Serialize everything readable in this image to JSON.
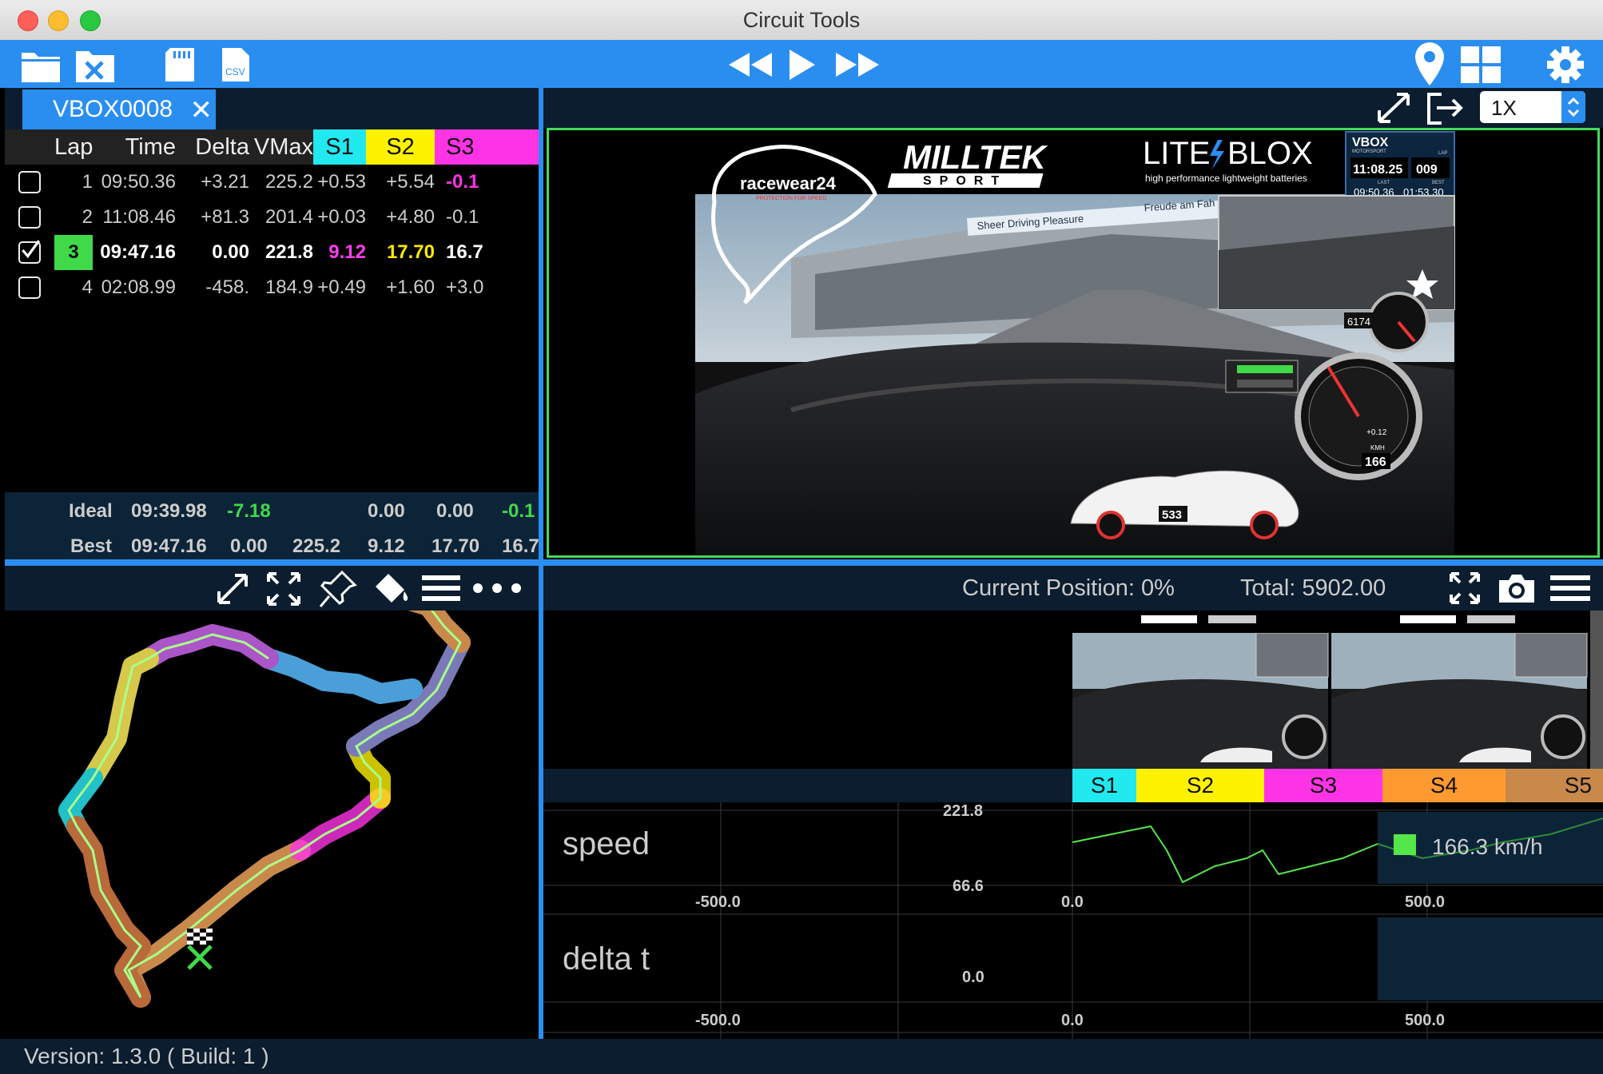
{
  "window": {
    "title": "Circuit Tools"
  },
  "toolbar": {
    "left_icons": [
      "folder-open-icon",
      "close-file-icon",
      "sd-card-icon",
      "csv-file-icon"
    ],
    "playback_icons": [
      "rewind-icon",
      "play-icon",
      "fast-forward-icon"
    ],
    "right_icons": [
      "map-pin-icon",
      "layout-grid-icon",
      "settings-gear-icon"
    ]
  },
  "session_tab": {
    "label": "VBOX0008",
    "close": "✕"
  },
  "lap_table": {
    "headers": [
      "Lap",
      "Time",
      "Delta",
      "VMax",
      "S1",
      "S2",
      "S3"
    ],
    "rows": [
      {
        "checked": false,
        "lap": "1",
        "time": "09:50.36",
        "delta": "+3.21",
        "vmax": "225.2",
        "s1": "+0.53",
        "s2": "+5.54",
        "s3": "-0.1"
      },
      {
        "checked": false,
        "lap": "2",
        "time": "11:08.46",
        "delta": "+81.3",
        "vmax": "201.4",
        "s1": "+0.03",
        "s2": "+4.80",
        "s3": "-0.1"
      },
      {
        "checked": true,
        "lap": "3",
        "time": "09:47.16",
        "delta": "0.00",
        "vmax": "221.8",
        "s1": "9.12",
        "s2": "17.70",
        "s3": "16.7"
      },
      {
        "checked": false,
        "lap": "4",
        "time": "02:08.99",
        "delta": "-458.",
        "vmax": "184.9",
        "s1": "+0.49",
        "s2": "+1.60",
        "s3": "+3.0"
      }
    ],
    "ideal": {
      "label": "Ideal",
      "time": "09:39.98",
      "delta": "-7.18",
      "s1": "0.00",
      "s2": "0.00",
      "s3": "-0.1"
    },
    "best": {
      "label": "Best",
      "time": "09:47.16",
      "delta": "0.00",
      "vmax": "225.2",
      "s1": "9.12",
      "s2": "17.70",
      "s3": "16.7"
    }
  },
  "video": {
    "speed_option": "1X",
    "overlay": {
      "brand_main": "MILLTEK",
      "brand_sub": "SPORT",
      "brand2_a": "LITE",
      "brand2_b": "BLOX",
      "brand2_tagline": "high performance lightweight batteries",
      "sponsor": "racewear24",
      "sponsor_tag": "PROTECTION FOR SPEED",
      "vbox_label": "VBOX",
      "vbox_sub": "MOTORSPORT",
      "vbox_time": "11:08.25",
      "vbox_lap_label": "LAP",
      "vbox_lap": "009",
      "vbox_last_label": "LAST",
      "vbox_last": "09:50.36",
      "vbox_best_label": "BEST",
      "vbox_best": "01:53.30",
      "banner1": "Sheer Driving Pleasure",
      "banner2": "Freude am Fah",
      "gauge_top": "6174",
      "gauge_speed": "166",
      "gauge_unit": "KMH",
      "gauge_delta": "+0.12",
      "car_number": "533"
    }
  },
  "map_toolbar": {
    "icons": [
      "expand-icon",
      "fit-icon",
      "pin-icon",
      "paint-bucket-icon",
      "list-icon",
      "more-icon"
    ]
  },
  "graph": {
    "current_position": "Current Position: 0%",
    "total": "Total: 5902.00",
    "sectors": [
      {
        "label": "S1",
        "color": "#22e8f0"
      },
      {
        "label": "S2",
        "color": "#fff200"
      },
      {
        "label": "S3",
        "color": "#ff33e6"
      },
      {
        "label": "S4",
        "color": "#ff9a30"
      },
      {
        "label": "S5",
        "color": "#c8894a"
      }
    ],
    "speed_label": "speed",
    "speed_max": "221.8",
    "speed_min": "66.6",
    "speed_readout": "166.3 km/h",
    "delta_label": "delta t",
    "delta_zero": "0.0",
    "x_neg": "-500.0",
    "x_zero": "0.0",
    "x_pos": "500.0"
  },
  "status": {
    "version": "Version: 1.3.0 ( Build: 1 )"
  },
  "colors": {
    "accent": "#2a8ef0",
    "panel": "#0b1d2e",
    "video_border": "#46d95c"
  }
}
